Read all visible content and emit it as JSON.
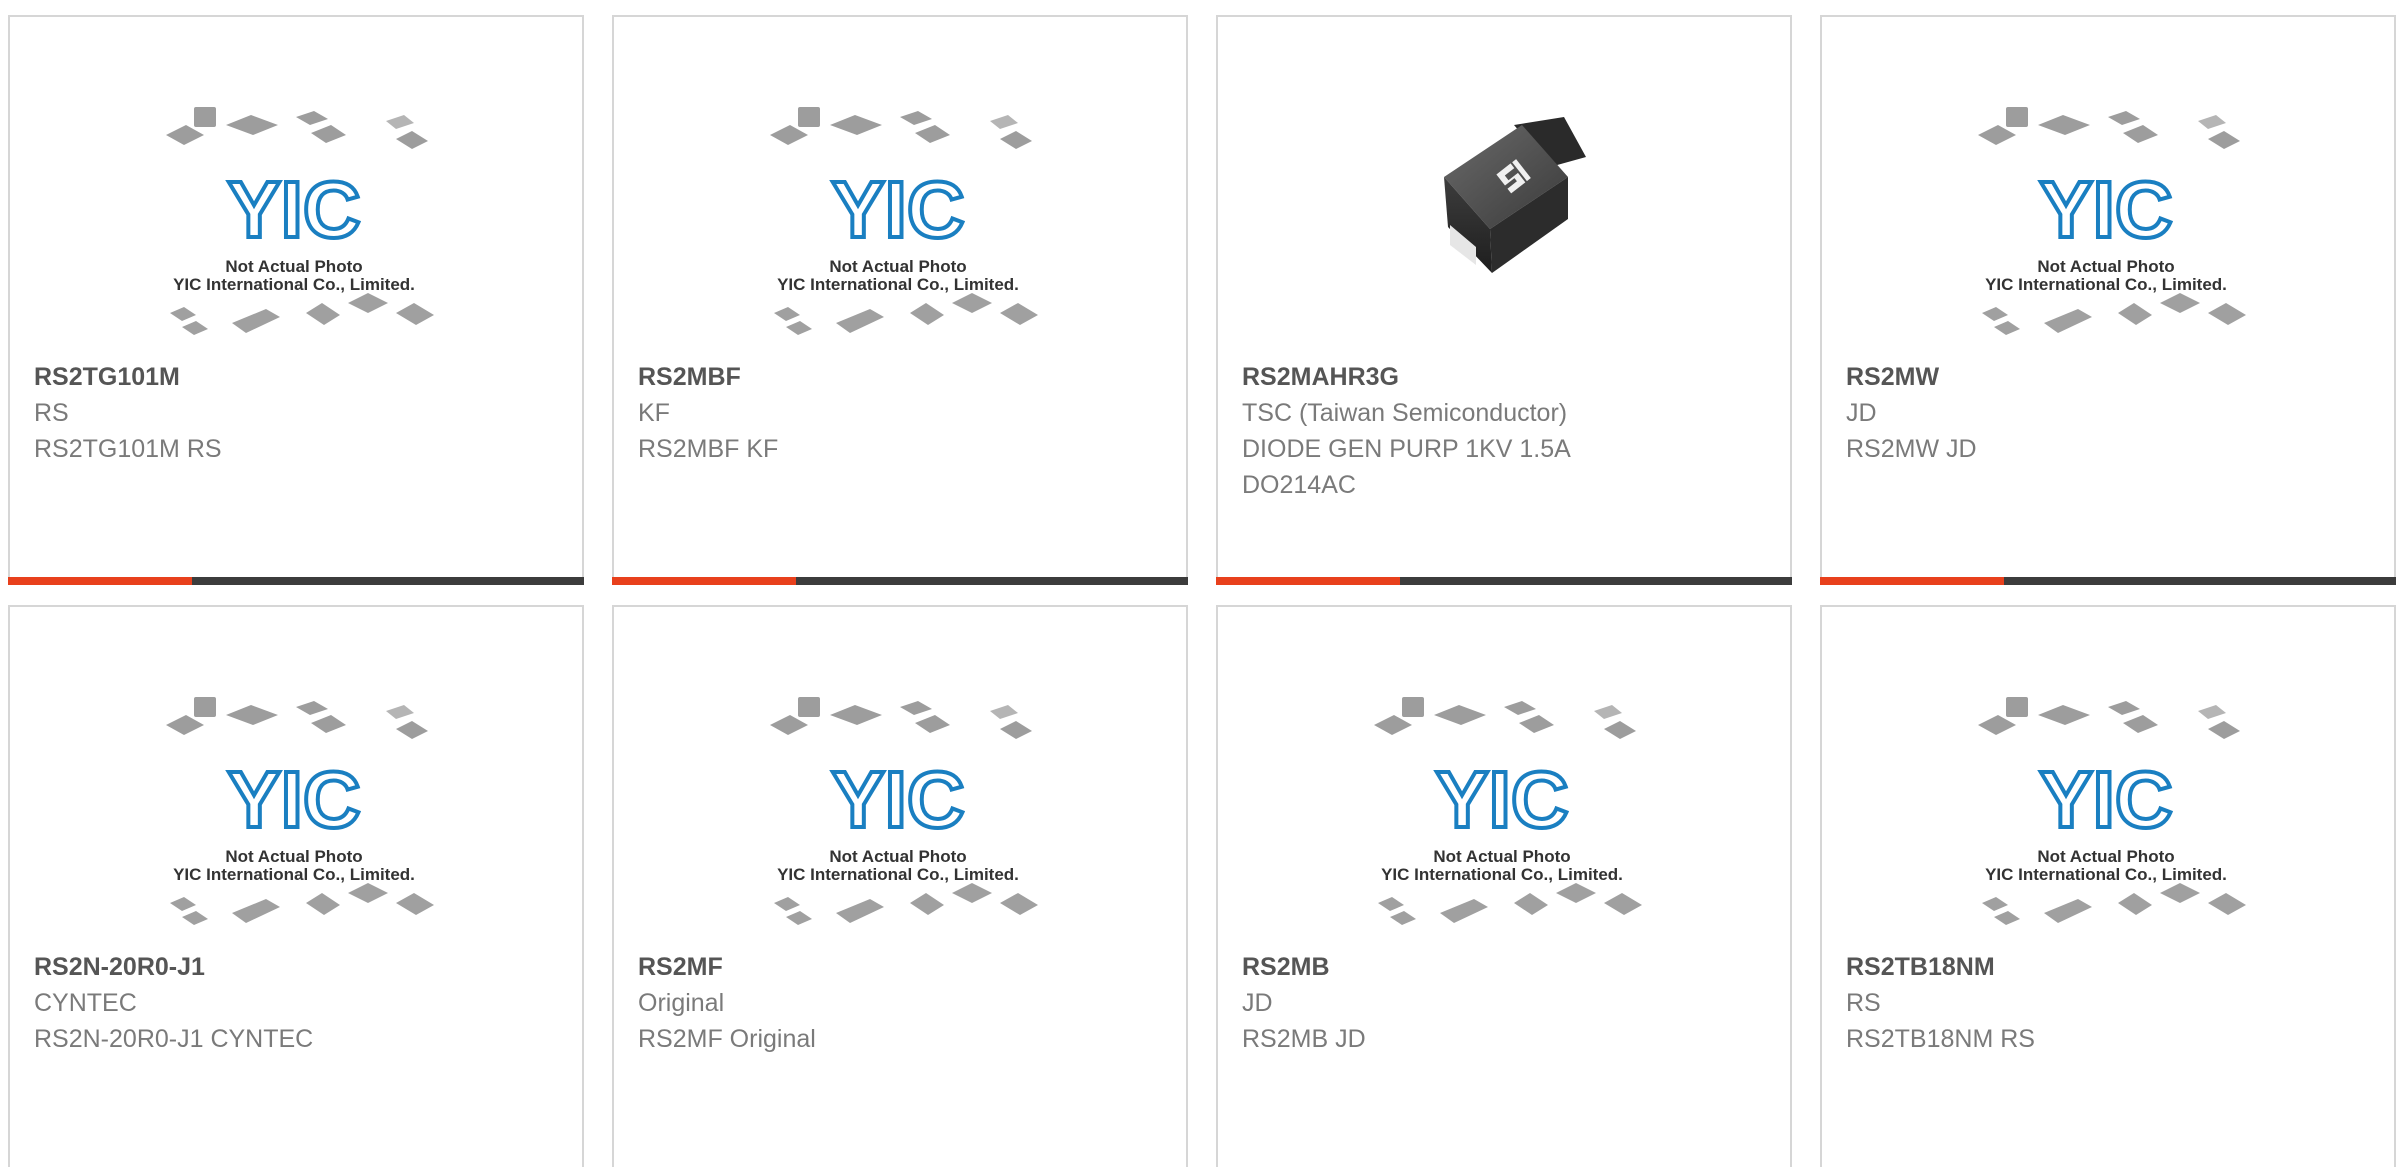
{
  "products": [
    {
      "part_number": "RS2TG101M",
      "brand": "RS",
      "description": "RS2TG101M RS",
      "image": "placeholder"
    },
    {
      "part_number": "RS2MBF",
      "brand": "KF",
      "description": "RS2MBF KF",
      "image": "placeholder"
    },
    {
      "part_number": "RS2MAHR3G",
      "brand": "TSC (Taiwan Semiconductor)",
      "description": "DIODE GEN PURP 1KV 1.5A",
      "description2": "DO214AC",
      "image": "diode-photo"
    },
    {
      "part_number": "RS2MW",
      "brand": "JD",
      "description": "RS2MW JD",
      "image": "placeholder"
    },
    {
      "part_number": "RS2N-20R0-J1",
      "brand": "CYNTEC",
      "description": "RS2N-20R0-J1 CYNTEC",
      "image": "placeholder"
    },
    {
      "part_number": "RS2MF",
      "brand": "Original",
      "description": "RS2MF Original",
      "image": "placeholder"
    },
    {
      "part_number": "RS2MB",
      "brand": "JD",
      "description": "RS2MB JD",
      "image": "placeholder"
    },
    {
      "part_number": "RS2TB18NM",
      "brand": "RS",
      "description": "RS2TB18NM RS",
      "image": "placeholder"
    }
  ],
  "placeholder": {
    "logo": "YIC",
    "caption_1": "Not Actual Photo",
    "caption_2": "YIC International Co., Limited."
  },
  "colors": {
    "accent": "#e8401c",
    "bar": "#3c3c3c",
    "logo_blue": "#1a7fc1",
    "border": "#d6d6d6"
  }
}
